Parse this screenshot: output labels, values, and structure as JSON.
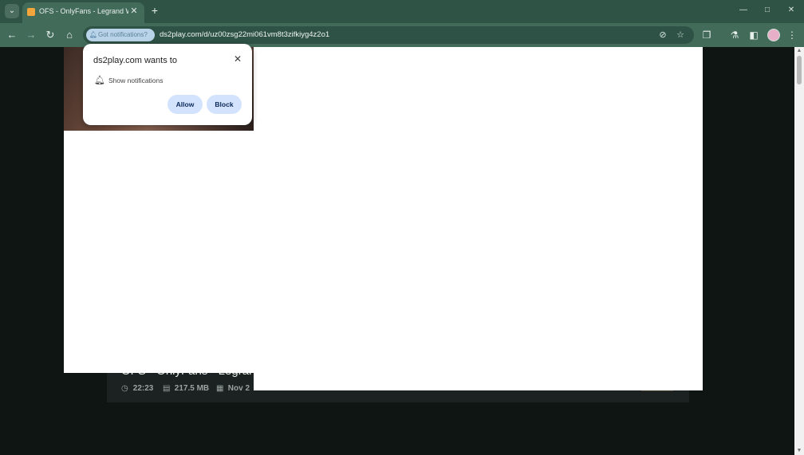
{
  "browser": {
    "tab": {
      "title": "OFS - OnlyFans - Legrand Wolf"
    },
    "address_bar": {
      "permission_chip": "Got notifications?",
      "url": "ds2play.com/d/uz00zsg22mi061vm8t3zifkiyg4z2o1"
    },
    "icons": {
      "tab_list": "chevron-down-icon",
      "new_tab": "plus-icon",
      "minimize": "minimize-icon",
      "maximize": "maximize-icon",
      "close": "close-icon",
      "back": "arrow-left-icon",
      "forward": "arrow-right-icon",
      "reload": "reload-icon",
      "home": "home-icon",
      "eye_off": "eye-off-icon",
      "bookmark": "star-icon",
      "extensions": "puzzle-icon",
      "labs": "flask-icon",
      "side_panel": "side-panel-icon",
      "menu": "kebab-menu-icon"
    }
  },
  "popup": {
    "title": "ds2play.com wants to",
    "permission": "Show notifications",
    "allow_label": "Allow",
    "block_label": "Block"
  },
  "video": {
    "title": "OFS - OnlyFans - Legrand",
    "duration": "22:23",
    "size": "217.5 MB",
    "date": "Nov 2"
  },
  "colors": {
    "chrome_dark": "#2f5446",
    "chrome_toolbar": "#426b5a",
    "page_bg": "#0f1513",
    "popup_button": "#d3e3fd"
  }
}
